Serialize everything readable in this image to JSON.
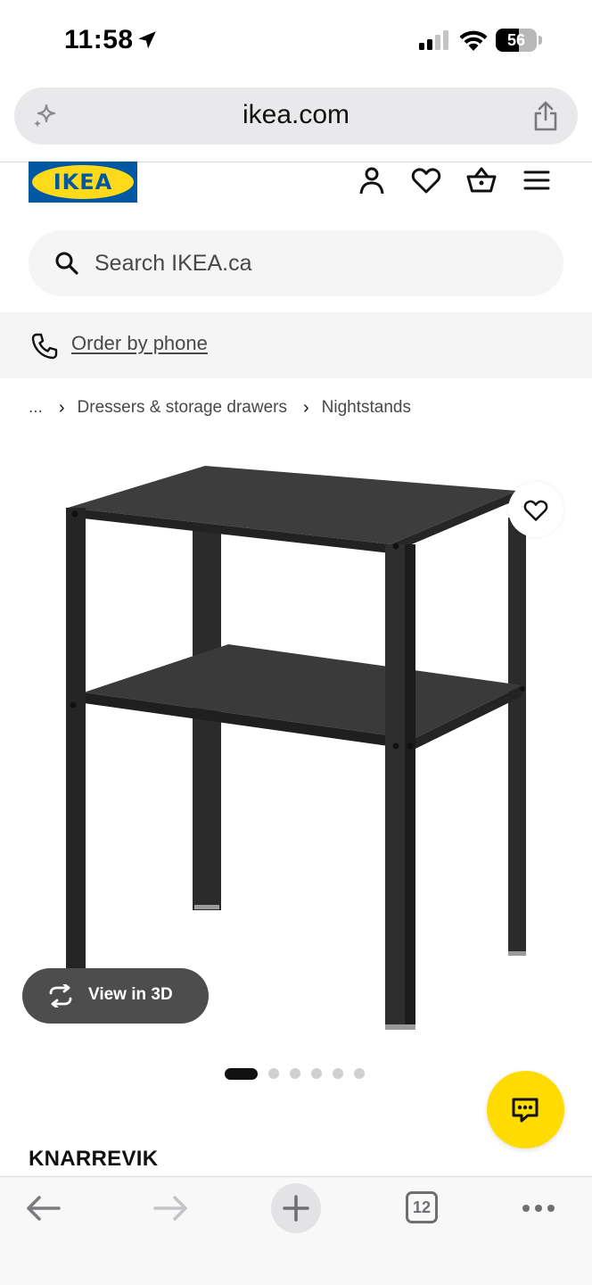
{
  "status_bar": {
    "time": "11:58",
    "battery_level": "56",
    "battery_fraction": 0.56
  },
  "browser": {
    "url": "ikea.com",
    "tab_count": "12"
  },
  "header": {
    "logo_text": "IKEA",
    "brand_blue": "#0058a3",
    "brand_yellow": "#ffda1a",
    "icons": [
      "user-icon",
      "heart-icon",
      "cart-icon",
      "menu-icon"
    ]
  },
  "search": {
    "placeholder": "Search IKEA.ca"
  },
  "phone": {
    "label": "Order by phone"
  },
  "breadcrumb": {
    "ellipsis": "...",
    "items": [
      "Dressers & storage drawers",
      "Nightstands"
    ]
  },
  "gallery": {
    "view3d_label": "View in 3D",
    "total_images": 6,
    "active_index": 0
  },
  "product": {
    "name": "KNARREVIK"
  },
  "chat": {
    "accent": "#ffdb00"
  }
}
